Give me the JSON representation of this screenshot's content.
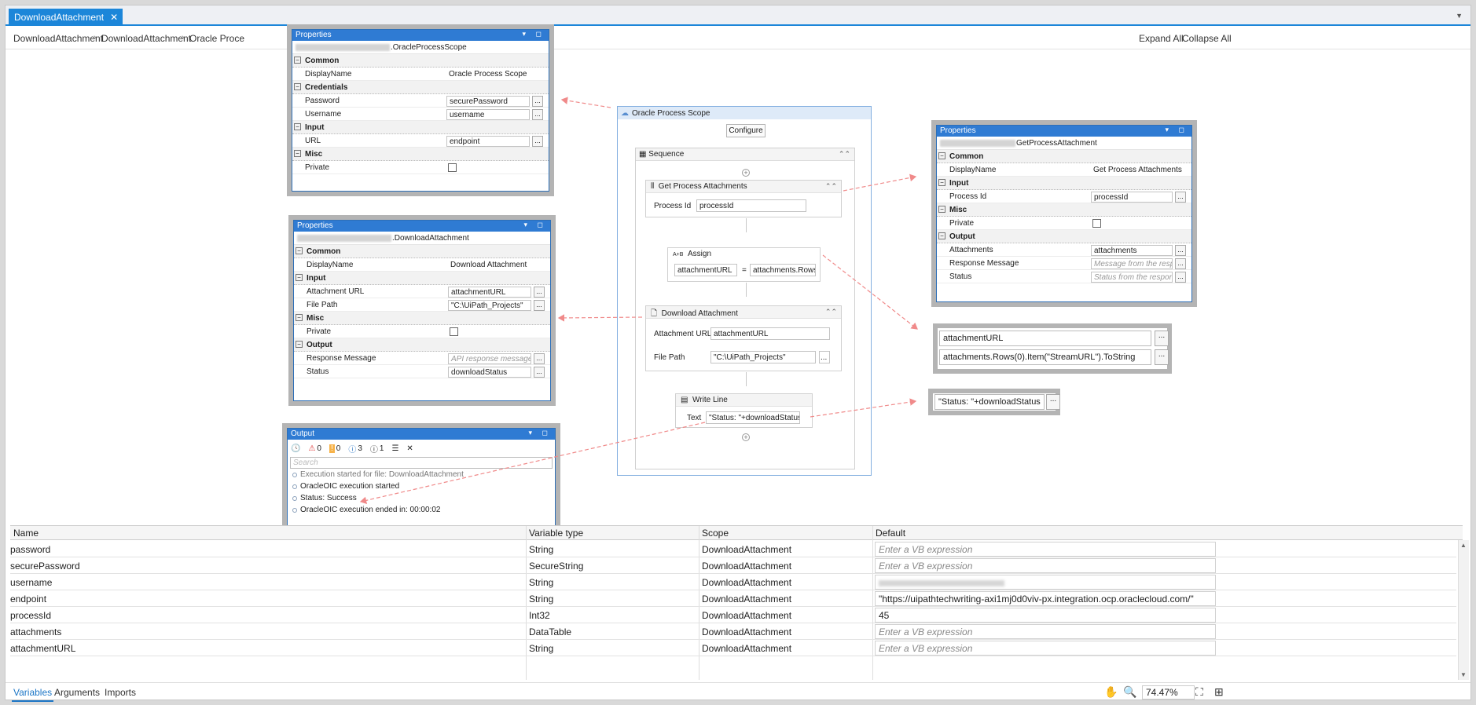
{
  "tab": {
    "title": "DownloadAttachment",
    "close": "✕"
  },
  "breadcrumb": [
    "DownloadAttachment",
    "DownloadAttachment",
    "Oracle Proce"
  ],
  "toolbar": {
    "expand_all": "Expand All",
    "collapse_all": "Collapse All"
  },
  "props_scope": {
    "title": "Properties",
    "type": ".OracleProcessScope",
    "cat_common": "Common",
    "display_name_label": "DisplayName",
    "display_name_value": "Oracle Process Scope",
    "cat_credentials": "Credentials",
    "password_label": "Password",
    "password_value": "securePassword",
    "username_label": "Username",
    "username_value": "username",
    "cat_input": "Input",
    "url_label": "URL",
    "url_value": "endpoint",
    "cat_misc": "Misc",
    "private_label": "Private"
  },
  "props_download": {
    "title": "Properties",
    "type": ".DownloadAttachment",
    "cat_common": "Common",
    "display_name_label": "DisplayName",
    "display_name_value": "Download Attachment",
    "cat_input": "Input",
    "attachment_url_label": "Attachment URL",
    "attachment_url_value": "attachmentURL",
    "file_path_label": "File Path",
    "file_path_value": "\"C:\\UiPath_Projects\"",
    "cat_misc": "Misc",
    "private_label": "Private",
    "cat_output": "Output",
    "response_label": "Response Message",
    "response_placeholder": "API response message i",
    "status_label": "Status",
    "status_value": "downloadStatus"
  },
  "props_get": {
    "title": "Properties",
    "type": "GetProcessAttachment",
    "cat_common": "Common",
    "display_name_label": "DisplayName",
    "display_name_value": "Get Process Attachments",
    "cat_input": "Input",
    "process_id_label": "Process Id",
    "process_id_value": "processId",
    "cat_misc": "Misc",
    "private_label": "Private",
    "cat_output": "Output",
    "attachments_label": "Attachments",
    "attachments_value": "attachments",
    "response_label": "Response Message",
    "response_placeholder": "Message from the respo",
    "status_label": "Status",
    "status_placeholder": "Status from the respons"
  },
  "output": {
    "title": "Output",
    "counts": {
      "errors": "0",
      "warnings": "0",
      "info": "3",
      "trace": "1"
    },
    "search_placeholder": "Search",
    "lines": [
      "Execution started for file: DownloadAttachment",
      "OracleOIC execution started",
      "Status: Success",
      "OracleOIC execution ended in: 00:00:02"
    ]
  },
  "workflow": {
    "scope_title": "Oracle Process Scope",
    "configure": "Configure",
    "sequence_title": "Sequence",
    "get_title": "Get Process Attachments",
    "process_id_label": "Process Id",
    "process_id_value": "processId",
    "assign_icon": "A+B",
    "assign_title": "Assign",
    "assign_to": "attachmentURL",
    "assign_eq": "=",
    "assign_value": "attachments.Rows",
    "download_title": "Download Attachment",
    "attachment_url_label": "Attachment URL",
    "attachment_url_value": "attachmentURL",
    "file_path_label": "File Path",
    "file_path_value": "\"C:\\UiPath_Projects\"",
    "writeline_title": "Write Line",
    "text_label": "Text",
    "text_value": "\"Status: \"+downloadStatus"
  },
  "callout_assign": {
    "to": "attachmentURL",
    "value": "attachments.Rows(0).Item(\"StreamURL\").ToString"
  },
  "callout_writeline": {
    "value": "\"Status: \"+downloadStatus"
  },
  "dots": "...",
  "variables": {
    "headers": [
      "Name",
      "Variable type",
      "Scope",
      "Default"
    ],
    "rows": [
      {
        "name": "password",
        "type": "String",
        "scope": "DownloadAttachment",
        "default": "",
        "placeholder": "Enter a VB expression"
      },
      {
        "name": "securePassword",
        "type": "SecureString",
        "scope": "DownloadAttachment",
        "default": "",
        "placeholder": "Enter a VB expression"
      },
      {
        "name": "username",
        "type": "String",
        "scope": "DownloadAttachment",
        "default": "",
        "placeholder": ""
      },
      {
        "name": "endpoint",
        "type": "String",
        "scope": "DownloadAttachment",
        "default": "\"https://uipathtechwriting-axi1mj0d0viv-px.integration.ocp.oraclecloud.com/\"",
        "placeholder": ""
      },
      {
        "name": "processId",
        "type": "Int32",
        "scope": "DownloadAttachment",
        "default": "45",
        "placeholder": ""
      },
      {
        "name": "attachments",
        "type": "DataTable",
        "scope": "DownloadAttachment",
        "default": "",
        "placeholder": "Enter a VB expression"
      },
      {
        "name": "attachmentURL",
        "type": "String",
        "scope": "DownloadAttachment",
        "default": "",
        "placeholder": "Enter a VB expression"
      }
    ]
  },
  "bottom": {
    "tabs": [
      "Variables",
      "Arguments",
      "Imports"
    ],
    "zoom": "74.47%"
  },
  "colors": {
    "accent": "#1c86d9",
    "arrow": "#f08a8a",
    "title": "#2f7bd3"
  }
}
